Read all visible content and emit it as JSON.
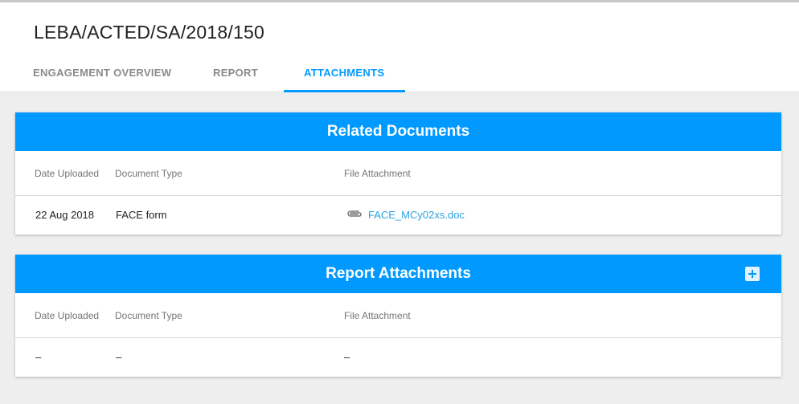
{
  "page": {
    "title": "LEBA/ACTED/SA/2018/150"
  },
  "tabs": [
    {
      "label": "ENGAGEMENT OVERVIEW",
      "active": false
    },
    {
      "label": "REPORT",
      "active": false
    },
    {
      "label": "ATTACHMENTS",
      "active": true
    }
  ],
  "colors": {
    "accent": "#0099ff",
    "link": "#29a3e3"
  },
  "related_documents": {
    "title": "Related Documents",
    "columns": [
      "Date Uploaded",
      "Document Type",
      "File Attachment"
    ],
    "rows": [
      {
        "date": "22 Aug 2018",
        "type": "FACE form",
        "file": "FACE_MCy02xs.doc",
        "icon": "paperclip-icon"
      }
    ]
  },
  "report_attachments": {
    "title": "Report Attachments",
    "add_icon": "add-icon",
    "columns": [
      "Date Uploaded",
      "Document Type",
      "File Attachment"
    ],
    "rows": [
      {
        "date": "–",
        "type": "–",
        "file": "–"
      }
    ]
  }
}
